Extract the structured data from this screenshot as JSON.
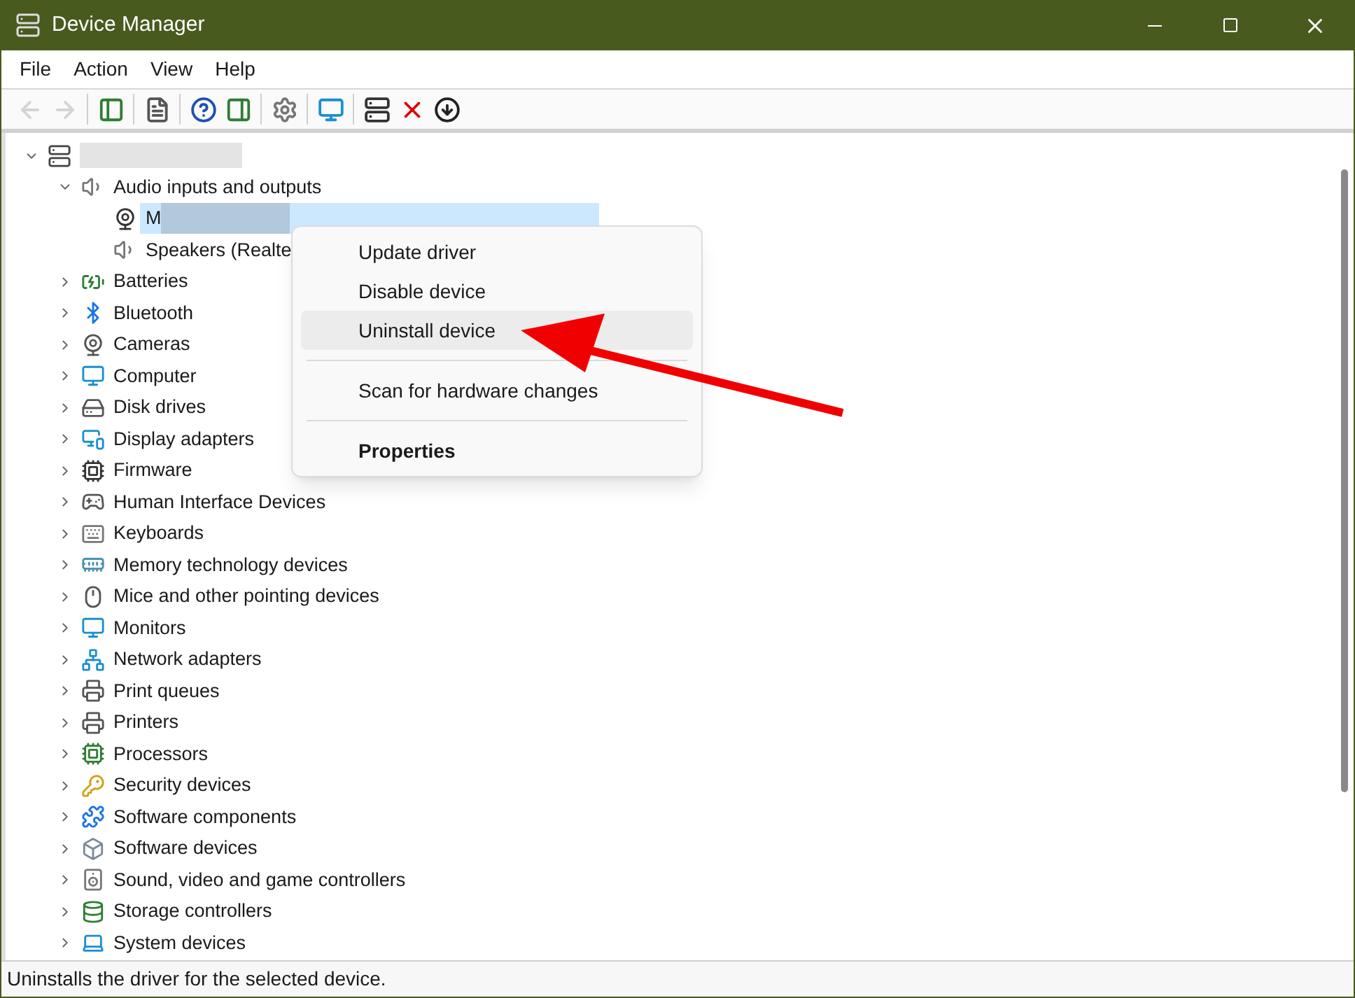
{
  "window": {
    "title": "Device Manager"
  },
  "menu_bar": [
    {
      "label": "File"
    },
    {
      "label": "Action"
    },
    {
      "label": "View"
    },
    {
      "label": "Help"
    }
  ],
  "toolbar": [
    [
      {
        "disabled": true
      },
      {
        "disabled": true
      }
    ],
    [
      {
        "disabled": false
      }
    ],
    [
      {
        "disabled": false
      }
    ],
    [
      {
        "disabled": false
      },
      {
        "disabled": false
      }
    ],
    [
      {
        "disabled": false
      }
    ],
    [
      {
        "disabled": false
      }
    ],
    [
      {
        "disabled": false
      },
      {
        "disabled": false
      },
      {
        "disabled": false
      }
    ]
  ],
  "tree": {
    "kind": "redacted",
    "expanded": true,
    "selected": false,
    "children": [
      {
        "kind": "plain",
        "label": "Audio inputs and outputs",
        "expanded": true,
        "selected": false,
        "children": [
          {
            "kind": "partly-redacted",
            "label_start": "M",
            "selected": true
          },
          {
            "kind": "plain",
            "label": "Speakers (Realte",
            "selected": false
          }
        ]
      },
      {
        "kind": "plain",
        "label": "Batteries",
        "expanded": false,
        "selected": false
      },
      {
        "kind": "plain",
        "label": "Bluetooth",
        "expanded": false,
        "selected": false
      },
      {
        "kind": "plain",
        "label": "Cameras",
        "expanded": false,
        "selected": false
      },
      {
        "kind": "plain",
        "label": "Computer",
        "expanded": false,
        "selected": false
      },
      {
        "kind": "plain",
        "label": "Disk drives",
        "expanded": false,
        "selected": false
      },
      {
        "kind": "plain",
        "label": "Display adapters",
        "expanded": false,
        "selected": false
      },
      {
        "kind": "plain",
        "label": "Firmware",
        "expanded": false,
        "selected": false
      },
      {
        "kind": "plain",
        "label": "Human Interface Devices",
        "expanded": false,
        "selected": false
      },
      {
        "kind": "plain",
        "label": "Keyboards",
        "expanded": false,
        "selected": false
      },
      {
        "kind": "plain",
        "label": "Memory technology devices",
        "expanded": false,
        "selected": false
      },
      {
        "kind": "plain",
        "label": "Mice and other pointing devices",
        "expanded": false,
        "selected": false
      },
      {
        "kind": "plain",
        "label": "Monitors",
        "expanded": false,
        "selected": false
      },
      {
        "kind": "plain",
        "label": "Network adapters",
        "expanded": false,
        "selected": false
      },
      {
        "kind": "plain",
        "label": "Print queues",
        "expanded": false,
        "selected": false
      },
      {
        "kind": "plain",
        "label": "Printers",
        "expanded": false,
        "selected": false
      },
      {
        "kind": "plain",
        "label": "Processors",
        "expanded": false,
        "selected": false
      },
      {
        "kind": "plain",
        "label": "Security devices",
        "expanded": false,
        "selected": false
      },
      {
        "kind": "plain",
        "label": "Software components",
        "expanded": false,
        "selected": false
      },
      {
        "kind": "plain",
        "label": "Software devices",
        "expanded": false,
        "selected": false
      },
      {
        "kind": "plain",
        "label": "Sound, video and game controllers",
        "expanded": false,
        "selected": false
      },
      {
        "kind": "plain",
        "label": "Storage controllers",
        "expanded": false,
        "selected": false
      },
      {
        "kind": "plain",
        "label": "System devices",
        "expanded": false,
        "selected": false
      }
    ]
  },
  "context_menu": [
    {
      "kind": "item",
      "label": "Update driver",
      "selected": false,
      "default": false
    },
    {
      "kind": "item",
      "label": "Disable device",
      "selected": false,
      "default": false
    },
    {
      "kind": "item",
      "label": "Uninstall device",
      "selected": true,
      "default": false
    },
    {
      "kind": "separator"
    },
    {
      "kind": "item",
      "label": "Scan for hardware changes",
      "selected": false,
      "default": false
    },
    {
      "kind": "separator"
    },
    {
      "kind": "item",
      "label": "Properties",
      "selected": false,
      "default": true
    }
  ],
  "status_bar": {
    "text": "Uninstalls the driver for the selected device."
  }
}
